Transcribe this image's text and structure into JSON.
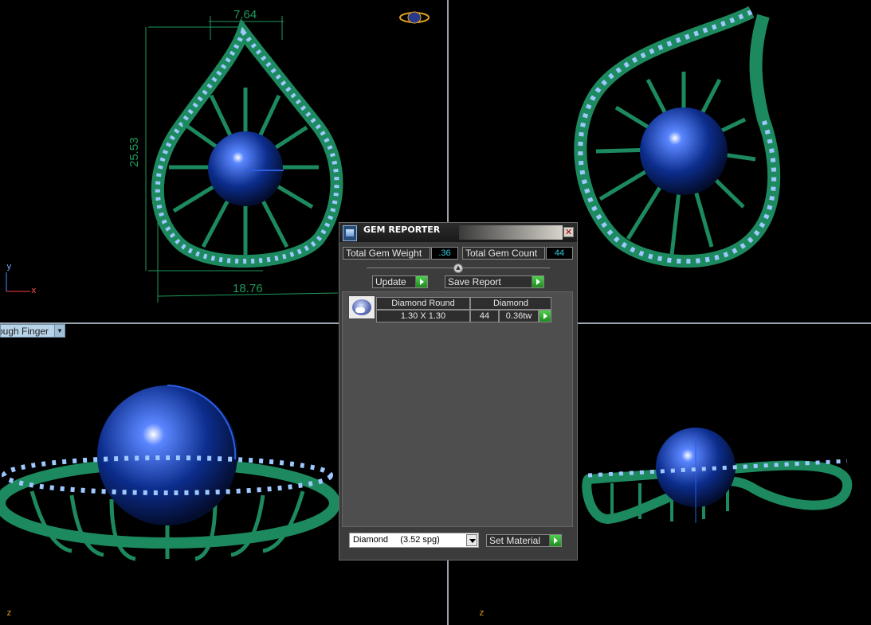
{
  "viewport_tl": {
    "dim_width_top": "7.64",
    "dim_height": "25.53",
    "dim_width_bottom": "18.76",
    "axis_y": "y",
    "axis_x": "x"
  },
  "viewport_bl": {
    "view_mode": "ough Finger",
    "axis_z": "z"
  },
  "viewport_br": {
    "axis_z": "z"
  },
  "gem_reporter": {
    "title": "GEM REPORTER",
    "total_gem_weight_label": "Total Gem Weight",
    "total_gem_weight_value": ".36",
    "total_gem_count_label": "Total Gem Count",
    "total_gem_count_value": "44",
    "update_label": "Update",
    "save_report_label": "Save Report",
    "table": {
      "col1_header": "Diamond Round",
      "col2_header": "Diamond",
      "size": "1.30 X 1.30",
      "count": "44",
      "weight": "0.36tw"
    },
    "material_select": "Diamond     (3.52 spg)",
    "set_material_label": "Set Material"
  },
  "colors": {
    "metal": "#1c8a5e",
    "pearl": "#0c2d8c",
    "stones": "#9ec8ff",
    "dimension": "#1f9a5c"
  }
}
